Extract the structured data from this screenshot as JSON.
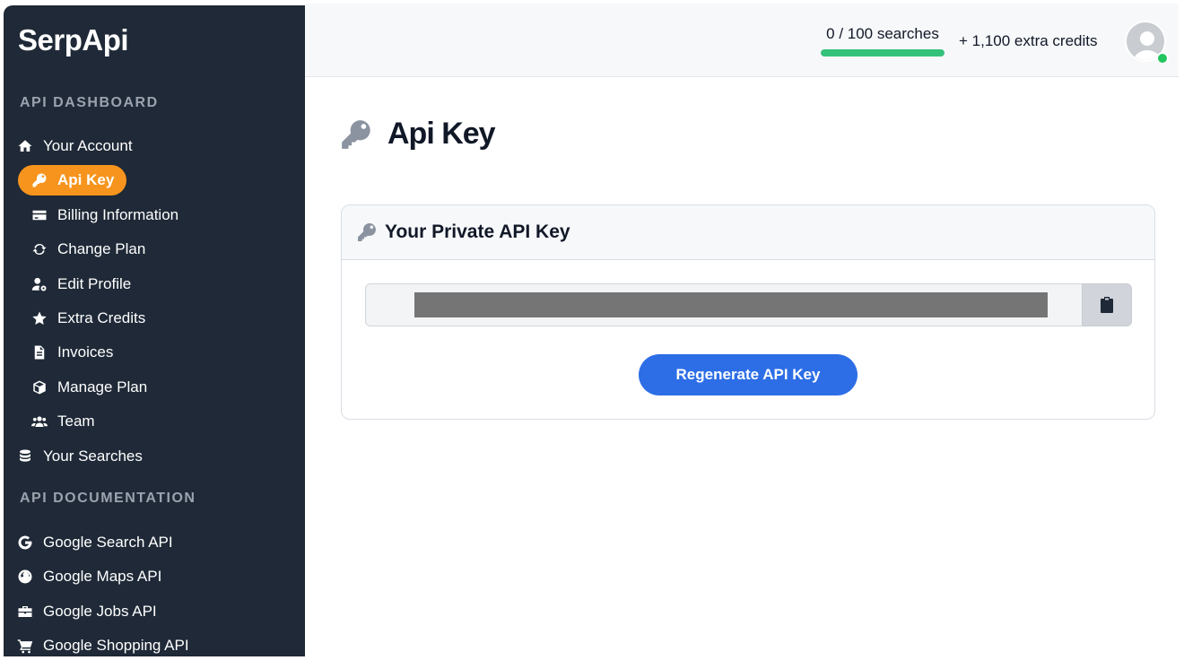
{
  "sidebar": {
    "logo": "SerpApi",
    "section_dashboard": "API DASHBOARD",
    "section_docs": "API DOCUMENTATION",
    "dashboard_items": [
      {
        "label": "Your Account",
        "icon": "home-icon"
      },
      {
        "label": "Api Key",
        "icon": "key-icon",
        "active": true
      },
      {
        "label": "Billing Information",
        "icon": "credit-card-icon"
      },
      {
        "label": "Change Plan",
        "icon": "sync-icon"
      },
      {
        "label": "Edit Profile",
        "icon": "user-cog-icon"
      },
      {
        "label": "Extra Credits",
        "icon": "star-icon"
      },
      {
        "label": "Invoices",
        "icon": "file-invoice-icon"
      },
      {
        "label": "Manage Plan",
        "icon": "box-icon"
      },
      {
        "label": "Team",
        "icon": "users-icon"
      },
      {
        "label": "Your Searches",
        "icon": "database-icon"
      }
    ],
    "doc_items": [
      {
        "label": "Google Search API",
        "icon": "google-icon"
      },
      {
        "label": "Google Maps API",
        "icon": "globe-icon"
      },
      {
        "label": "Google Jobs API",
        "icon": "briefcase-icon"
      },
      {
        "label": "Google Shopping API",
        "icon": "shopping-cart-icon"
      }
    ],
    "active_color": "#f7941d",
    "background": "#1f2937"
  },
  "topbar": {
    "usage_text": "0 / 100 searches",
    "usage_fraction": 1.0,
    "usage_bar_color": "#34c27b",
    "extra_credits": "+ 1,100 extra credits",
    "avatar_icon": "user-avatar-icon",
    "online_status_color": "#22c55e"
  },
  "main": {
    "page_title": "Api Key",
    "card": {
      "title": "Your Private API Key",
      "copy_icon": "clipboard-icon",
      "regenerate_label": "Regenerate API Key",
      "button_color": "#2d6ee6"
    }
  }
}
